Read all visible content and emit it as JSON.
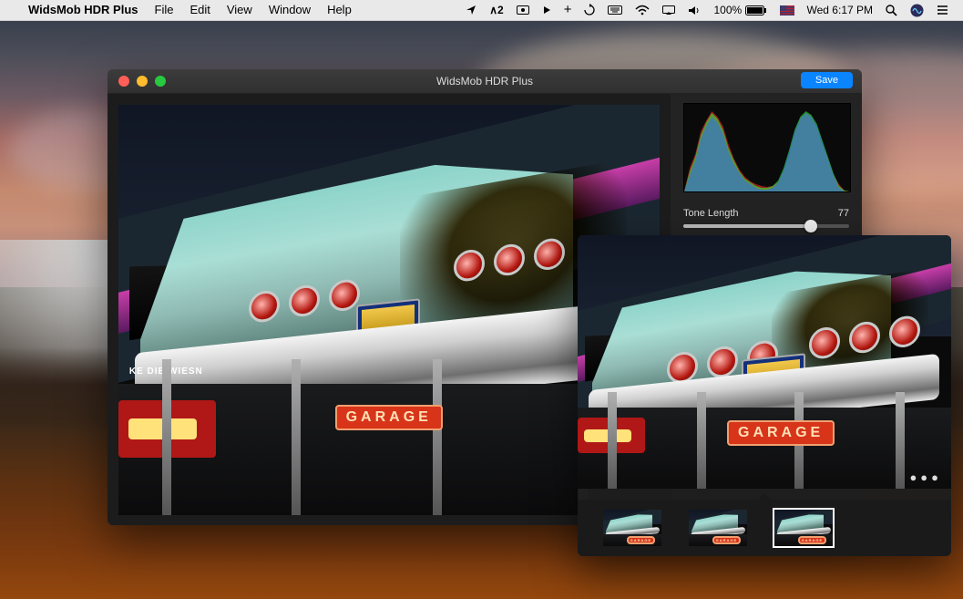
{
  "menubar": {
    "app": "WidsMob HDR Plus",
    "items": [
      "File",
      "Edit",
      "View",
      "Window",
      "Help"
    ],
    "right": {
      "adobe": "2",
      "battery": "100%",
      "clock": "Wed 6:17 PM"
    }
  },
  "app": {
    "title": "WidsMob HDR Plus",
    "save": "Save",
    "controls": [
      {
        "label": "Tone Length",
        "value": "77",
        "pct": 77
      }
    ],
    "photo": {
      "sign": "GARAGE",
      "banner": "KE DIE WIESN"
    }
  }
}
